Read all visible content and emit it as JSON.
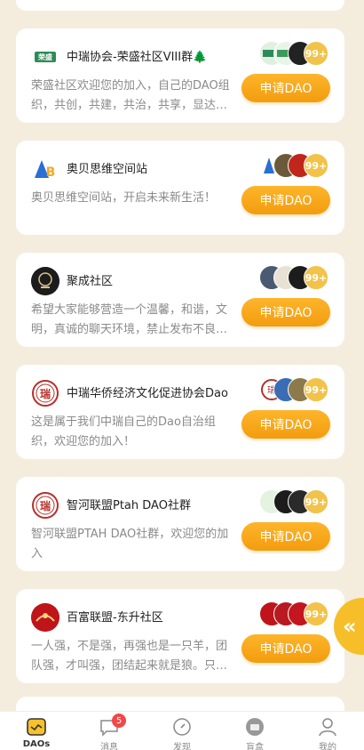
{
  "cards": [
    {
      "name": "中瑞协会-荣盛社区VIII群🌲",
      "description": "荣盛社区欢迎您的加入，自己的DAO组织，共创，共建，共治，共享，显达…",
      "button": "申请DAO",
      "member_count": "99+",
      "logo": {
        "icon": "rongsheng-logo",
        "color": "#2e8b57",
        "text": "荣盛"
      }
    },
    {
      "name": "奥贝思维空间站",
      "description": "奥贝思维空间站，开启未来新生活！",
      "button": "申请DAO",
      "member_count": "99+",
      "logo": {
        "icon": "ab-logo",
        "color": "#2a6fd1",
        "text": "AB"
      }
    },
    {
      "name": "聚成社区",
      "description": "希望大家能够营造一个温馨，和谐，文明，真诚的聊天环境，禁止发布不良…",
      "button": "申请DAO",
      "member_count": "99+",
      "logo": {
        "icon": "jucheng-logo",
        "color": "#1c1c1c",
        "text": "聚"
      }
    },
    {
      "name": "中瑞华侨经济文化促进协会Dao",
      "description": "这是属于我们中瑞自己的Dao自治组织，欢迎您的加入！",
      "button": "申请DAO",
      "member_count": "99+",
      "logo": {
        "icon": "zhongrui-seal-logo",
        "color": "#b5302a",
        "text": "瑞"
      }
    },
    {
      "name": "智河联盟Ptah DAO社群",
      "description": "智河联盟PTAH DAO社群，欢迎您的加入",
      "button": "申请DAO",
      "member_count": "99+",
      "logo": {
        "icon": "zhihe-seal-logo",
        "color": "#b5302a",
        "text": "瑞"
      }
    },
    {
      "name": "百富联盟-东升社区",
      "description": "一人强，不是强，再强也是一只羊，团队强，才叫强，团结起来就是狼。只…",
      "button": "申请DAO",
      "member_count": "99+",
      "logo": {
        "icon": "baifu-logo",
        "color": "#c0141b",
        "text": ""
      }
    }
  ],
  "float_button": {
    "icon": "double-chevron-left-icon",
    "glyph": "«"
  },
  "tabbar": [
    {
      "label": "DAOs",
      "icon": "daos-icon",
      "active": true
    },
    {
      "label": "消息",
      "icon": "message-icon",
      "badge": "5"
    },
    {
      "label": "发现",
      "icon": "compass-icon"
    },
    {
      "label": "盲盒",
      "icon": "blind-box-icon"
    },
    {
      "label": "我的",
      "icon": "profile-icon"
    }
  ],
  "colors": {
    "background": "#f4ecdd",
    "accent": "#f5a91c",
    "badge": "#f24747",
    "member_count": "#f1c34a"
  }
}
